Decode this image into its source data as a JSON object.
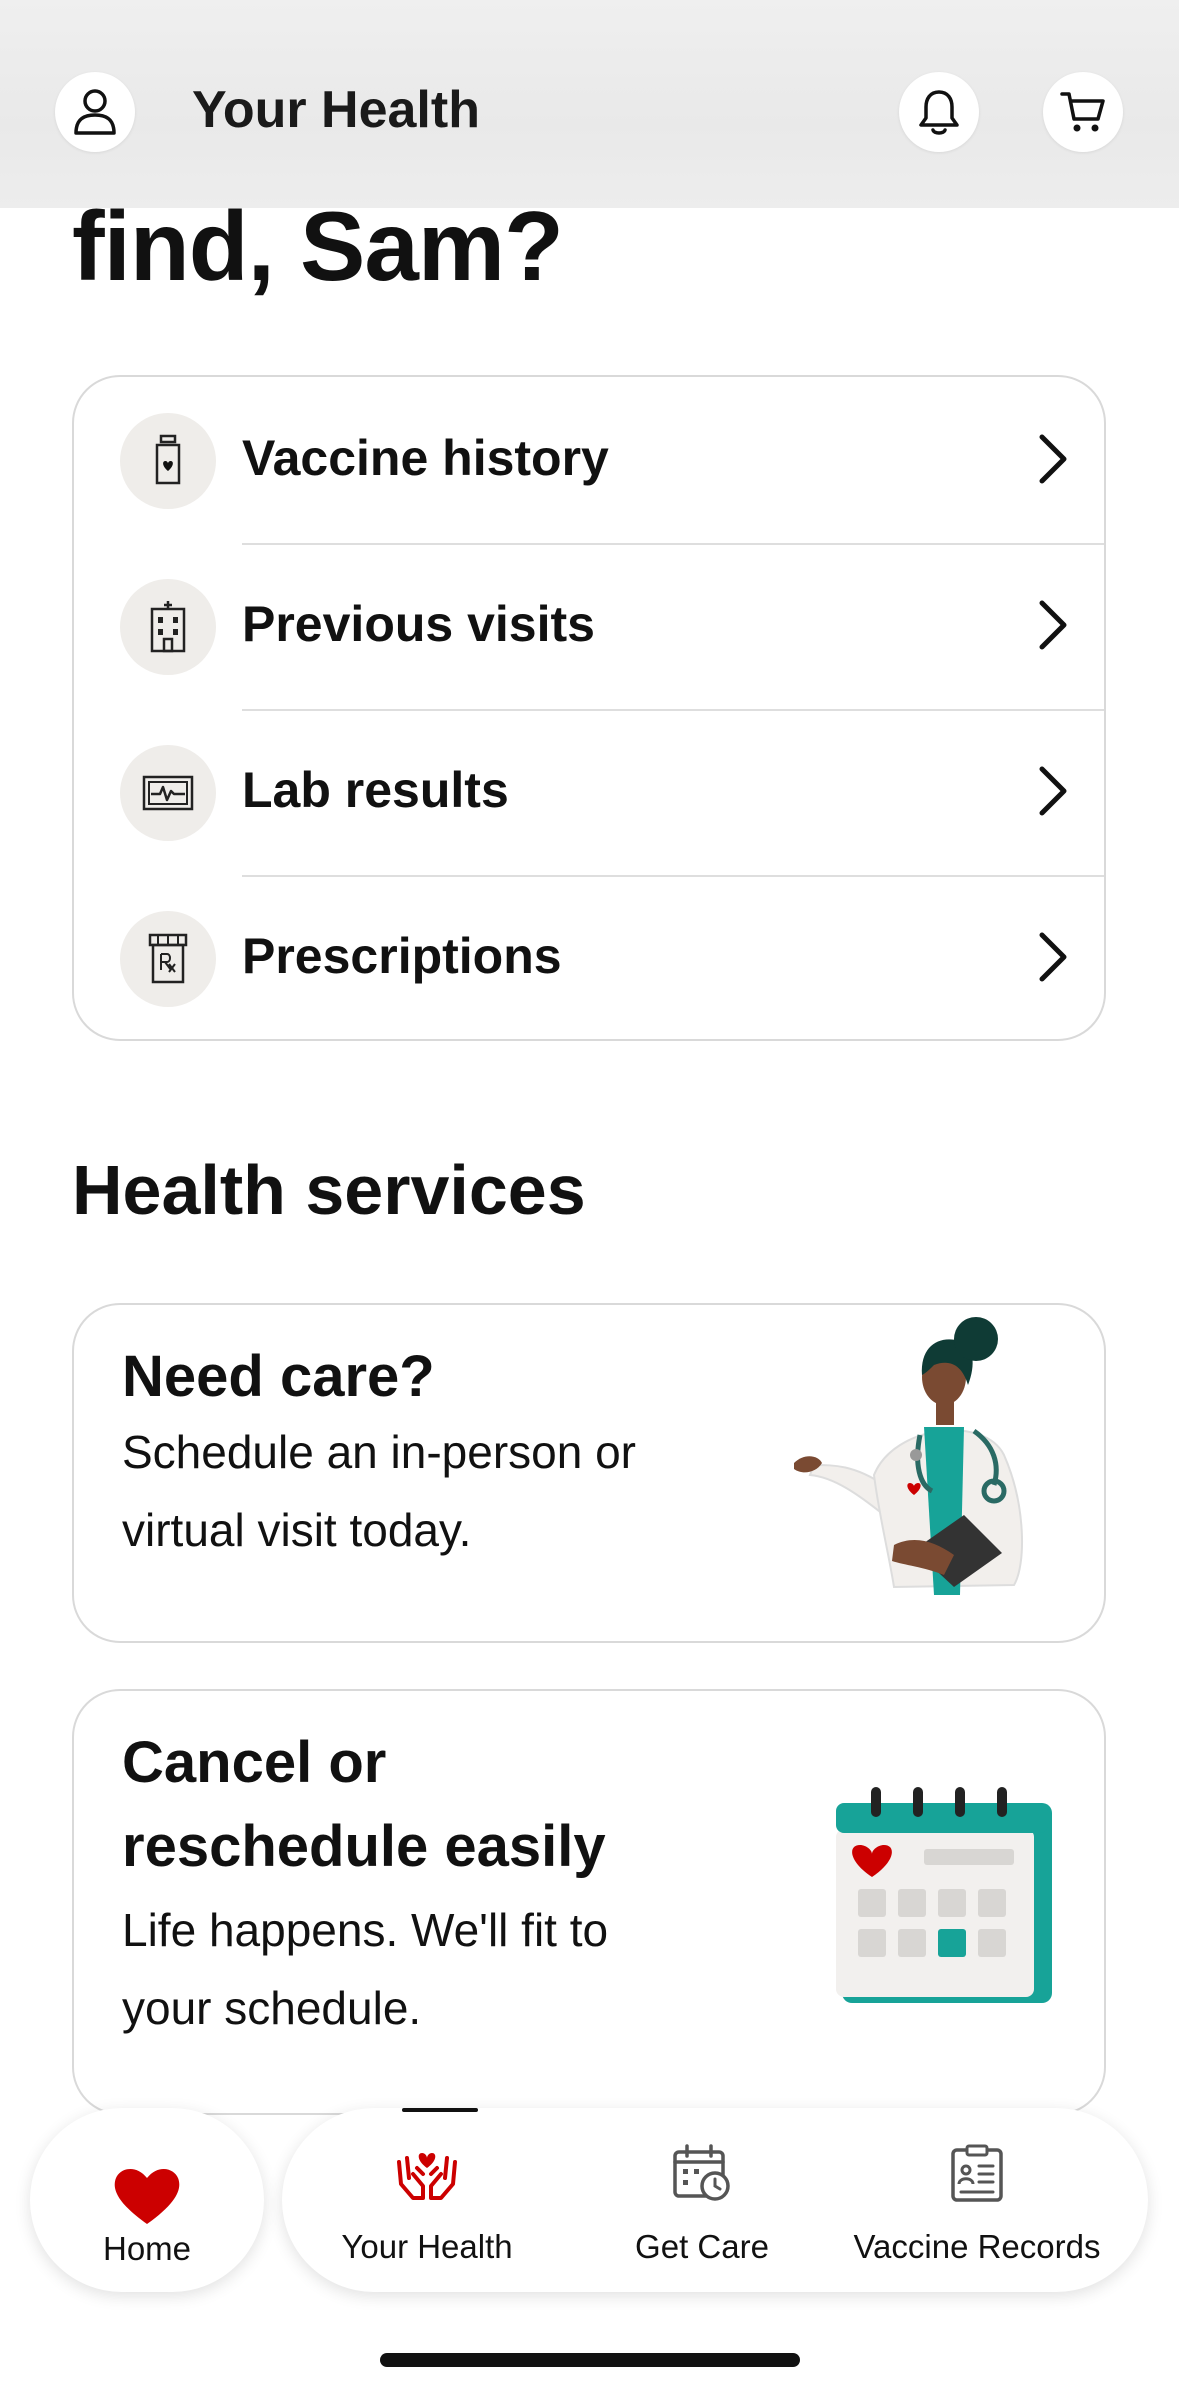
{
  "header": {
    "title": "Your Health",
    "profile_icon": "person-icon",
    "notifications_icon": "bell-icon",
    "cart_icon": "cart-icon"
  },
  "greeting": "find, Sam?",
  "records_menu": [
    {
      "label": "Vaccine history",
      "icon": "vaccine-vial-icon"
    },
    {
      "label": "Previous visits",
      "icon": "hospital-building-icon"
    },
    {
      "label": "Lab results",
      "icon": "monitor-pulse-icon"
    },
    {
      "label": "Prescriptions",
      "icon": "rx-bottle-icon"
    }
  ],
  "health_services": {
    "title": "Health services",
    "cards": [
      {
        "title": "Need care?",
        "desc_line1": "Schedule an in-person or",
        "desc_line2": "virtual visit today.",
        "illustration": "doctor-illustration"
      },
      {
        "title_line1": "Cancel or",
        "title_line2": "reschedule easily",
        "desc_line1": "Life happens. We'll fit to",
        "desc_line2": "your schedule.",
        "illustration": "calendar-illustration"
      }
    ]
  },
  "bottom_nav": {
    "items": [
      {
        "label": "Home",
        "icon": "heart-icon"
      },
      {
        "label": "Your Health",
        "icon": "hands-heart-icon",
        "active": true
      },
      {
        "label": "Get Care",
        "icon": "calendar-clock-icon"
      },
      {
        "label": "Vaccine Records",
        "icon": "clipboard-list-icon"
      }
    ]
  },
  "colors": {
    "brand_red": "#cc0000",
    "teal": "#17a398",
    "text": "#111111"
  }
}
